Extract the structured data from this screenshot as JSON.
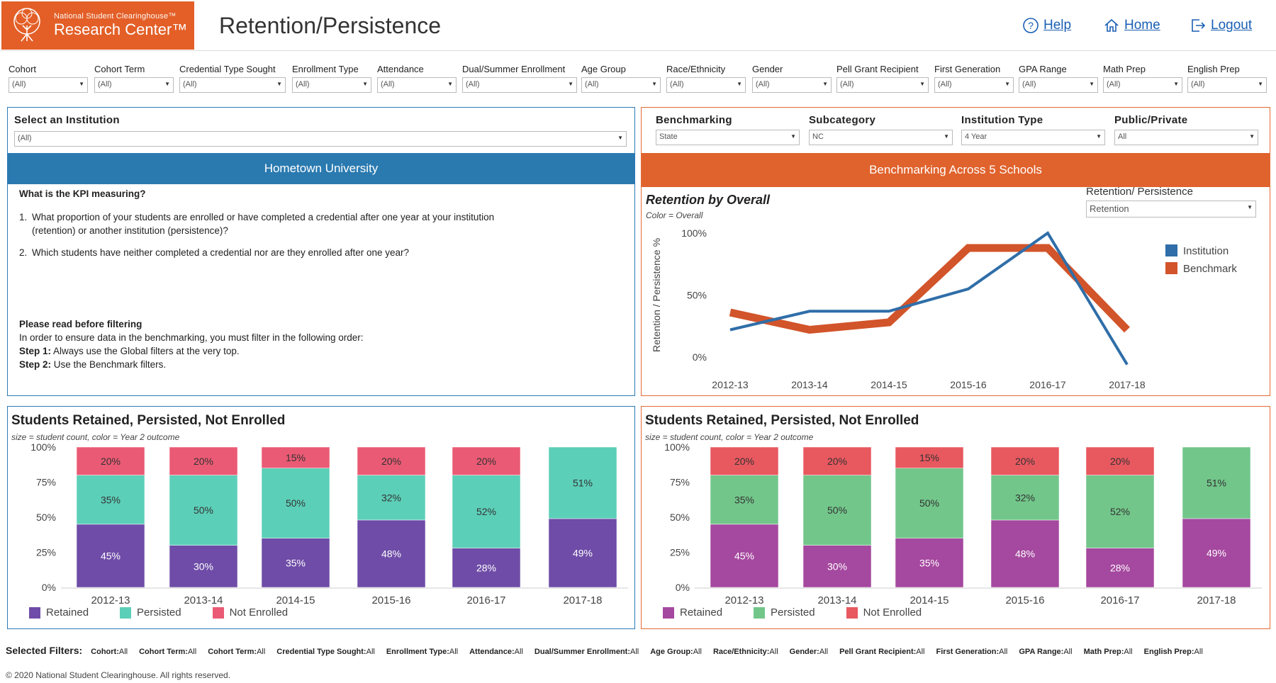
{
  "header": {
    "logo_small": "National Student Clearinghouse™",
    "logo_big": "Research Center™",
    "title": "Retention/Persistence",
    "links": {
      "help": "Help",
      "home": "Home",
      "logout": "Logout"
    }
  },
  "global_filters": [
    {
      "label": "Cohort",
      "value": "(All)"
    },
    {
      "label": "Cohort Term",
      "value": "(All)"
    },
    {
      "label": "Credential Type Sought",
      "value": "(All)"
    },
    {
      "label": "Enrollment Type",
      "value": "(All)"
    },
    {
      "label": "Attendance",
      "value": "(All)"
    },
    {
      "label": "Dual/Summer Enrollment",
      "value": "(All)"
    },
    {
      "label": "Age Group",
      "value": "(All)"
    },
    {
      "label": "Race/Ethnicity",
      "value": "(All)"
    },
    {
      "label": "Gender",
      "value": "(All)"
    },
    {
      "label": "Pell Grant Recipient",
      "value": "(All)"
    },
    {
      "label": "First Generation",
      "value": "(All)"
    },
    {
      "label": "GPA Range",
      "value": "(All)"
    },
    {
      "label": "Math Prep",
      "value": "(All)"
    },
    {
      "label": "English Prep",
      "value": "(All)"
    }
  ],
  "left_panel": {
    "select_label": "Select an Institution",
    "select_value": "(All)",
    "bar_title": "Hometown University",
    "bar_color": "#2a7ab0",
    "kpi_heading": "What is the KPI measuring?",
    "questions": [
      {
        "num": "1.",
        "text": "What proportion of your students are enrolled or have completed a credential after one year at your institution (retention) or another institution (persistence)?"
      },
      {
        "num": "2.",
        "text": "Which students have neither completed a credential nor are they enrolled after one year?"
      }
    ],
    "read_heading": "Please read before filtering",
    "read_text": "In order to ensure data in the benchmarking, you must filter in the following order:",
    "step1_label": "Step 1:",
    "step1_text": " Always use the Global filters at the very top.",
    "step2_label": "Step 2:",
    "step2_text": " Use the Benchmark filters."
  },
  "right_panel": {
    "filters": [
      {
        "label": "Benchmarking",
        "value": "State"
      },
      {
        "label": "Subcategory",
        "value": "NC"
      },
      {
        "label": "Institution Type",
        "value": "4 Year"
      },
      {
        "label": "Public/Private",
        "value": "All"
      }
    ],
    "bar_title": "Benchmarking Across 5 Schools",
    "bar_color": "#e0622c",
    "line_title": "Retention by Overall",
    "line_sub": "Color = Overall",
    "rp_label": "Retention/ Persistence",
    "rp_value": "Retention"
  },
  "bottom_left": {
    "title": "Students Retained, Persisted, Not Enrolled",
    "sub": "size = student count, color = Year 2 outcome",
    "legend": [
      "Retained",
      "Persisted",
      "Not Enrolled"
    ]
  },
  "bottom_right": {
    "title": "Students Retained, Persisted, Not Enrolled",
    "sub": "size = student count, color = Year 2 outcome",
    "legend": [
      "Retained",
      "Persisted",
      "Not Enrolled"
    ]
  },
  "selected_filters": {
    "heading": "Selected Filters:",
    "items": [
      {
        "label": "Cohort:",
        "value": "All"
      },
      {
        "label": "Cohort Term:",
        "value": "All"
      },
      {
        "label": "Cohort Term:",
        "value": "All"
      },
      {
        "label": "Credential Type Sought:",
        "value": "All"
      },
      {
        "label": "Enrollment Type:",
        "value": "All"
      },
      {
        "label": "Attendance:",
        "value": "All"
      },
      {
        "label": "Dual/Summer Enrollment:",
        "value": "All"
      },
      {
        "label": "Age Group:",
        "value": "All"
      },
      {
        "label": "Race/Ethnicity:",
        "value": "All"
      },
      {
        "label": "Gender:",
        "value": "All"
      },
      {
        "label": "Pell Grant Recipient:",
        "value": "All"
      },
      {
        "label": "First Generation:",
        "value": "All"
      },
      {
        "label": "GPA Range:",
        "value": "All"
      },
      {
        "label": "Math Prep:",
        "value": "All"
      },
      {
        "label": "English Prep:",
        "value": "All"
      }
    ]
  },
  "copyright": "© 2020 National Student Clearinghouse. All rights reserved.",
  "chart_data": [
    {
      "type": "line",
      "title": "Retention by Overall",
      "subtitle": "Color = Overall",
      "ylabel": "Retention / Persistence %",
      "categories": [
        "2012-13",
        "2013-14",
        "2014-15",
        "2015-16",
        "2016-17",
        "2017-18"
      ],
      "ylim": [
        0,
        100
      ],
      "yticks": [
        "0%",
        "50%",
        "100%"
      ],
      "series": [
        {
          "name": "Institution",
          "color": "#2f6ea8",
          "values": [
            22,
            37,
            37,
            55,
            100,
            -6
          ]
        },
        {
          "name": "Benchmark",
          "color": "#d2542a",
          "values": [
            36,
            22,
            28,
            88,
            88,
            22
          ]
        }
      ],
      "legend": "right"
    },
    {
      "type": "bar",
      "stacked": true,
      "title": "Students Retained, Persisted, Not Enrolled",
      "categories": [
        "2012-13",
        "2013-14",
        "2014-15",
        "2015-16",
        "2016-17",
        "2017-18"
      ],
      "yticks": [
        "0%",
        "25%",
        "50%",
        "75%",
        "100%"
      ],
      "series": [
        {
          "name": "Retained",
          "color": "#6e4ca7",
          "values": [
            45,
            30,
            35,
            48,
            28,
            49
          ]
        },
        {
          "name": "Persisted",
          "color": "#5ccfb8",
          "values": [
            35,
            50,
            50,
            32,
            52,
            51
          ]
        },
        {
          "name": "Not Enrolled",
          "color": "#ea5a74",
          "values": [
            20,
            20,
            15,
            20,
            20,
            0
          ]
        }
      ]
    },
    {
      "type": "bar",
      "stacked": true,
      "title": "Students Retained, Persisted, Not Enrolled",
      "categories": [
        "2012-13",
        "2013-14",
        "2014-15",
        "2015-16",
        "2016-17",
        "2017-18"
      ],
      "yticks": [
        "0%",
        "25%",
        "50%",
        "75%",
        "100%"
      ],
      "series": [
        {
          "name": "Retained",
          "color": "#a5489f",
          "values": [
            45,
            30,
            35,
            48,
            28,
            49
          ]
        },
        {
          "name": "Persisted",
          "color": "#72c68a",
          "values": [
            35,
            50,
            50,
            32,
            52,
            51
          ]
        },
        {
          "name": "Not Enrolled",
          "color": "#e8585f",
          "values": [
            20,
            20,
            15,
            20,
            20,
            0
          ]
        }
      ]
    }
  ]
}
